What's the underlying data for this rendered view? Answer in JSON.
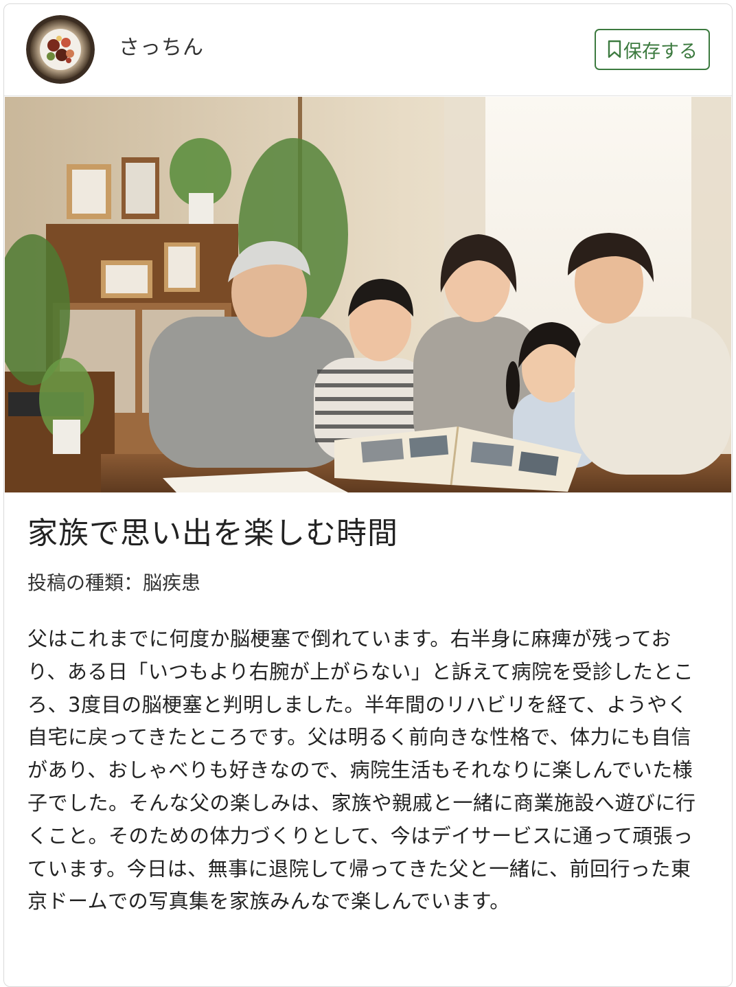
{
  "post": {
    "author": "さっちん",
    "save_label": "保存する",
    "title": "家族で思い出を楽しむ時間",
    "post_type": "投稿の種類：脳疾患",
    "body": "父はこれまでに何度か脳梗塞で倒れています。右半身に麻痺が残っており、ある日「いつもより右腕が上がらない」と訴えて病院を受診したところ、3度目の脳梗塞と判明しました。半年間のリハビリを経て、ようやく自宅に戻ってきたところです。父は明るく前向きな性格で、体力にも自信があり、おしゃべりも好きなので、病院生活もそれなりに楽しんでいた様子でした。そんな父の楽しみは、家族や親戚と一緒に商業施設へ遊びに行くこと。そのための体力づくりとして、今はデイサービスに通って頑張っています。今日は、無事に退院して帰ってきた父と一緒に、前回行った東京ドームでの写真集を家族みんなで楽しんでいます。"
  },
  "icons": {
    "save": "bookmark-icon"
  },
  "colors": {
    "accent": "#3c7a3f",
    "border": "#d9d9d9"
  }
}
